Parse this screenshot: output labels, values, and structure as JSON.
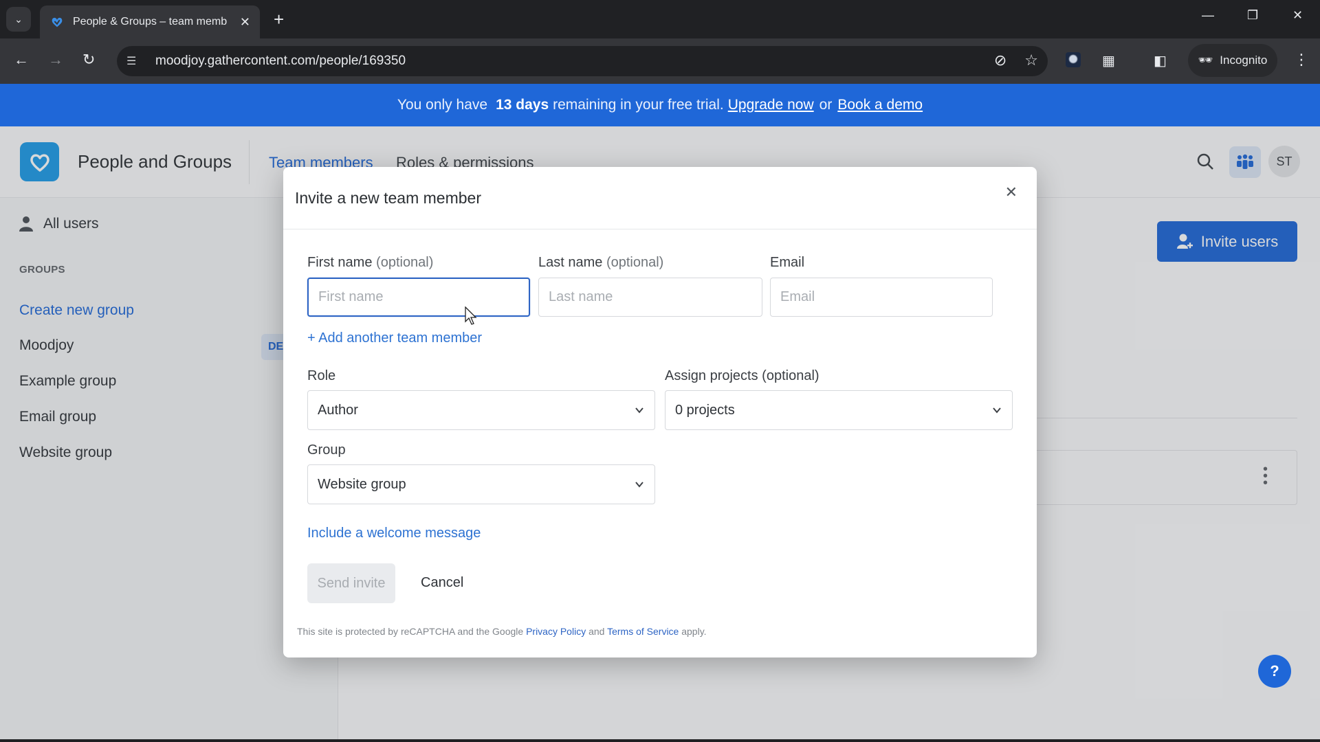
{
  "browser": {
    "tab_title": "People & Groups – team memb",
    "url": "moodjoy.gathercontent.com/people/169350",
    "profile_label": "Incognito"
  },
  "banner": {
    "prefix": "You only have",
    "days": "13 days",
    "suffix": "remaining in your free trial.",
    "upgrade_link": "Upgrade now",
    "or": "or",
    "demo_link": "Book a demo",
    "color": "#1f67d8"
  },
  "header": {
    "app_title": "People and Groups",
    "tabs": [
      {
        "label": "Team members",
        "active": true
      },
      {
        "label": "Roles & permissions",
        "active": false
      }
    ],
    "avatar_initials": "ST"
  },
  "sidebar": {
    "all_users": "All users",
    "groups_heading": "GROUPS",
    "create_group": "Create new group",
    "groups": [
      "Moodjoy",
      "Example group",
      "Email group",
      "Website group"
    ],
    "badge": "DE"
  },
  "main": {
    "invite_button": "Invite users"
  },
  "modal": {
    "title": "Invite a new team member",
    "first_name": {
      "label": "First name",
      "optional": "(optional)",
      "placeholder": "First name",
      "value": ""
    },
    "last_name": {
      "label": "Last name",
      "optional": "(optional)",
      "placeholder": "Last name",
      "value": ""
    },
    "email": {
      "label": "Email",
      "placeholder": "Email",
      "value": ""
    },
    "add_another": "+ Add another team member",
    "role": {
      "label": "Role",
      "value": "Author"
    },
    "projects": {
      "label": "Assign projects (optional)",
      "value": "0 projects"
    },
    "group": {
      "label": "Group",
      "value": "Website group"
    },
    "welcome_link": "Include a welcome message",
    "send_button": "Send invite",
    "cancel_button": "Cancel",
    "recaptcha": {
      "prefix": "This site is protected by reCAPTCHA and the Google",
      "privacy": "Privacy Policy",
      "and": "and",
      "terms": "Terms of Service",
      "suffix": "apply."
    }
  },
  "help_button": "?"
}
